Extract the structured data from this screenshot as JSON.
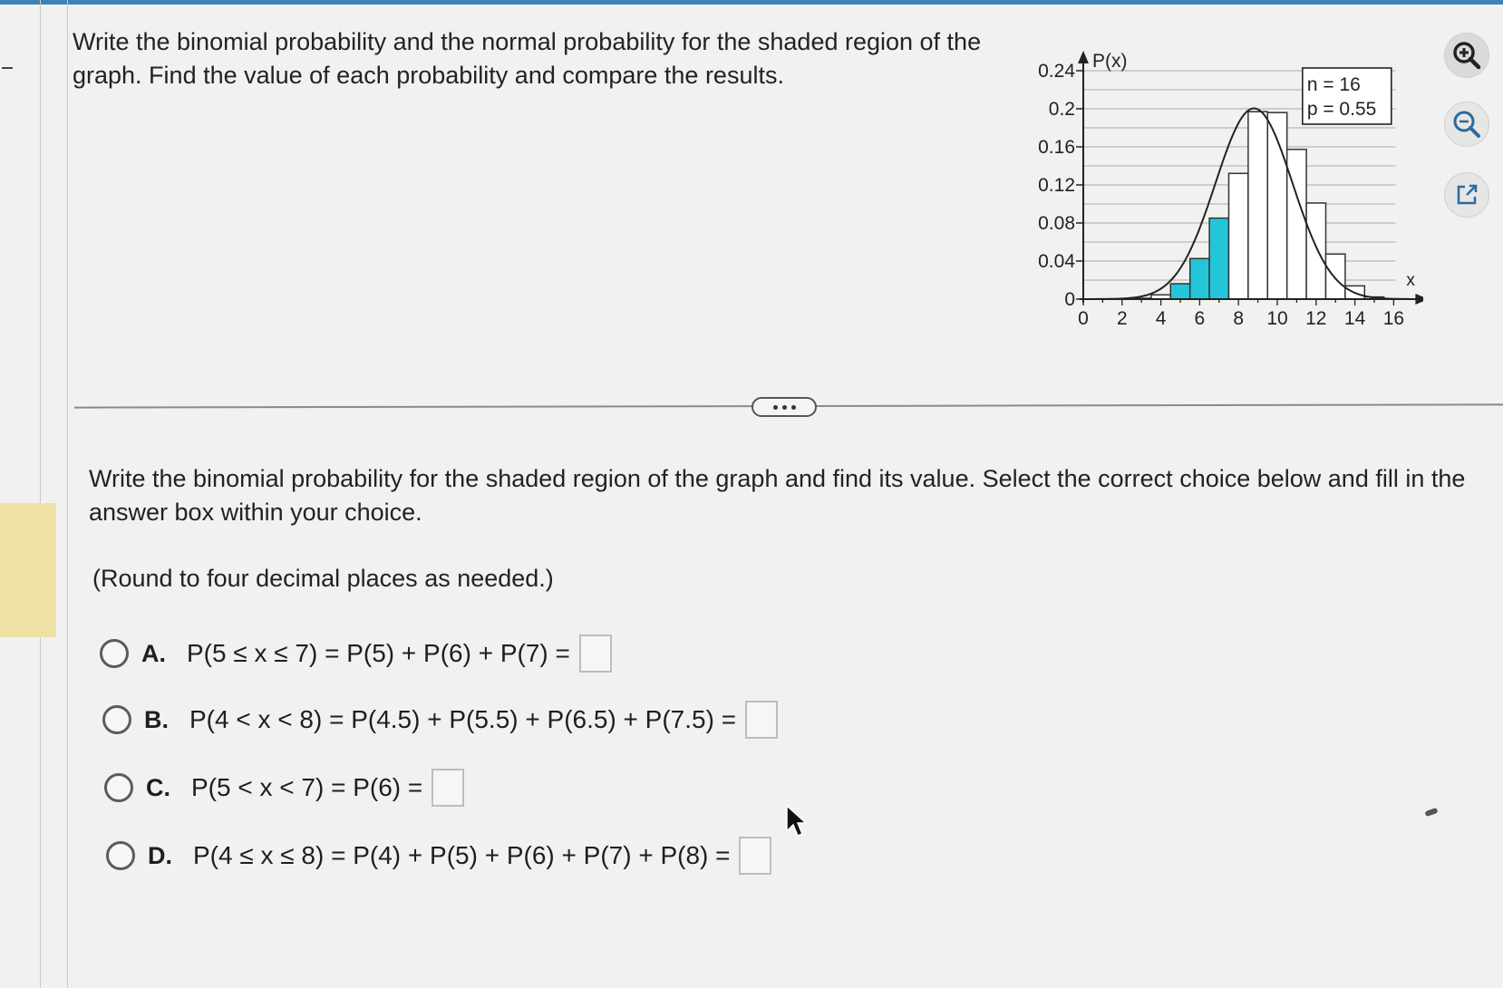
{
  "question": {
    "text": "Write the binomial probability and the normal probability for the shaded region of the graph. Find the value of each probability and compare the results."
  },
  "graph_icons": {
    "zoom_in": "zoom-in-icon",
    "zoom_out": "zoom-out-icon",
    "pop_out": "pop-out-icon"
  },
  "chart_data": {
    "type": "bar",
    "ylabel": "P(x)",
    "xlabel": "x",
    "legend": [
      "n = 16",
      "p = 0.55"
    ],
    "legend_position": "top-right",
    "x": [
      0,
      1,
      2,
      3,
      4,
      5,
      6,
      7,
      8,
      9,
      10,
      11,
      12,
      13,
      14,
      15,
      16
    ],
    "values": [
      0.0,
      0.0,
      0.0001,
      0.0009,
      0.0045,
      0.0162,
      0.0426,
      0.0851,
      0.1321,
      0.1969,
      0.196,
      0.1573,
      0.101,
      0.0474,
      0.0139,
      0.0023,
      0.0002
    ],
    "shaded_x": [
      5,
      6,
      7
    ],
    "xticks": [
      "0",
      "2",
      "4",
      "6",
      "8",
      "10",
      "12",
      "14",
      "16"
    ],
    "yticks": [
      "0",
      "0.04",
      "0.08",
      "0.12",
      "0.16",
      "0.2",
      "0.24"
    ],
    "xlim": [
      0,
      16
    ],
    "ylim": [
      0,
      0.24
    ],
    "grid": true,
    "normal_curve": true,
    "colors": {
      "shaded": "#22c6d8",
      "bar": "#ffffff",
      "line": "#222222"
    }
  },
  "part": {
    "instruction": "Write the binomial probability for the shaded region of the graph and find its value. Select the correct choice below and fill in the answer box within your choice.",
    "note": "(Round to four decimal places as needed.)"
  },
  "choices": [
    {
      "letter": "A.",
      "expr": "P(5 ≤ x ≤ 7) = P(5) + P(6) + P(7) ="
    },
    {
      "letter": "B.",
      "expr": "P(4 < x < 8) = P(4.5) + P(5.5) + P(6.5) + P(7.5) ="
    },
    {
      "letter": "C.",
      "expr": "P(5 < x < 7) = P(6) ="
    },
    {
      "letter": "D.",
      "expr": "P(4 ≤ x ≤ 8) = P(4) + P(5) + P(6) + P(7) + P(8) ="
    }
  ]
}
